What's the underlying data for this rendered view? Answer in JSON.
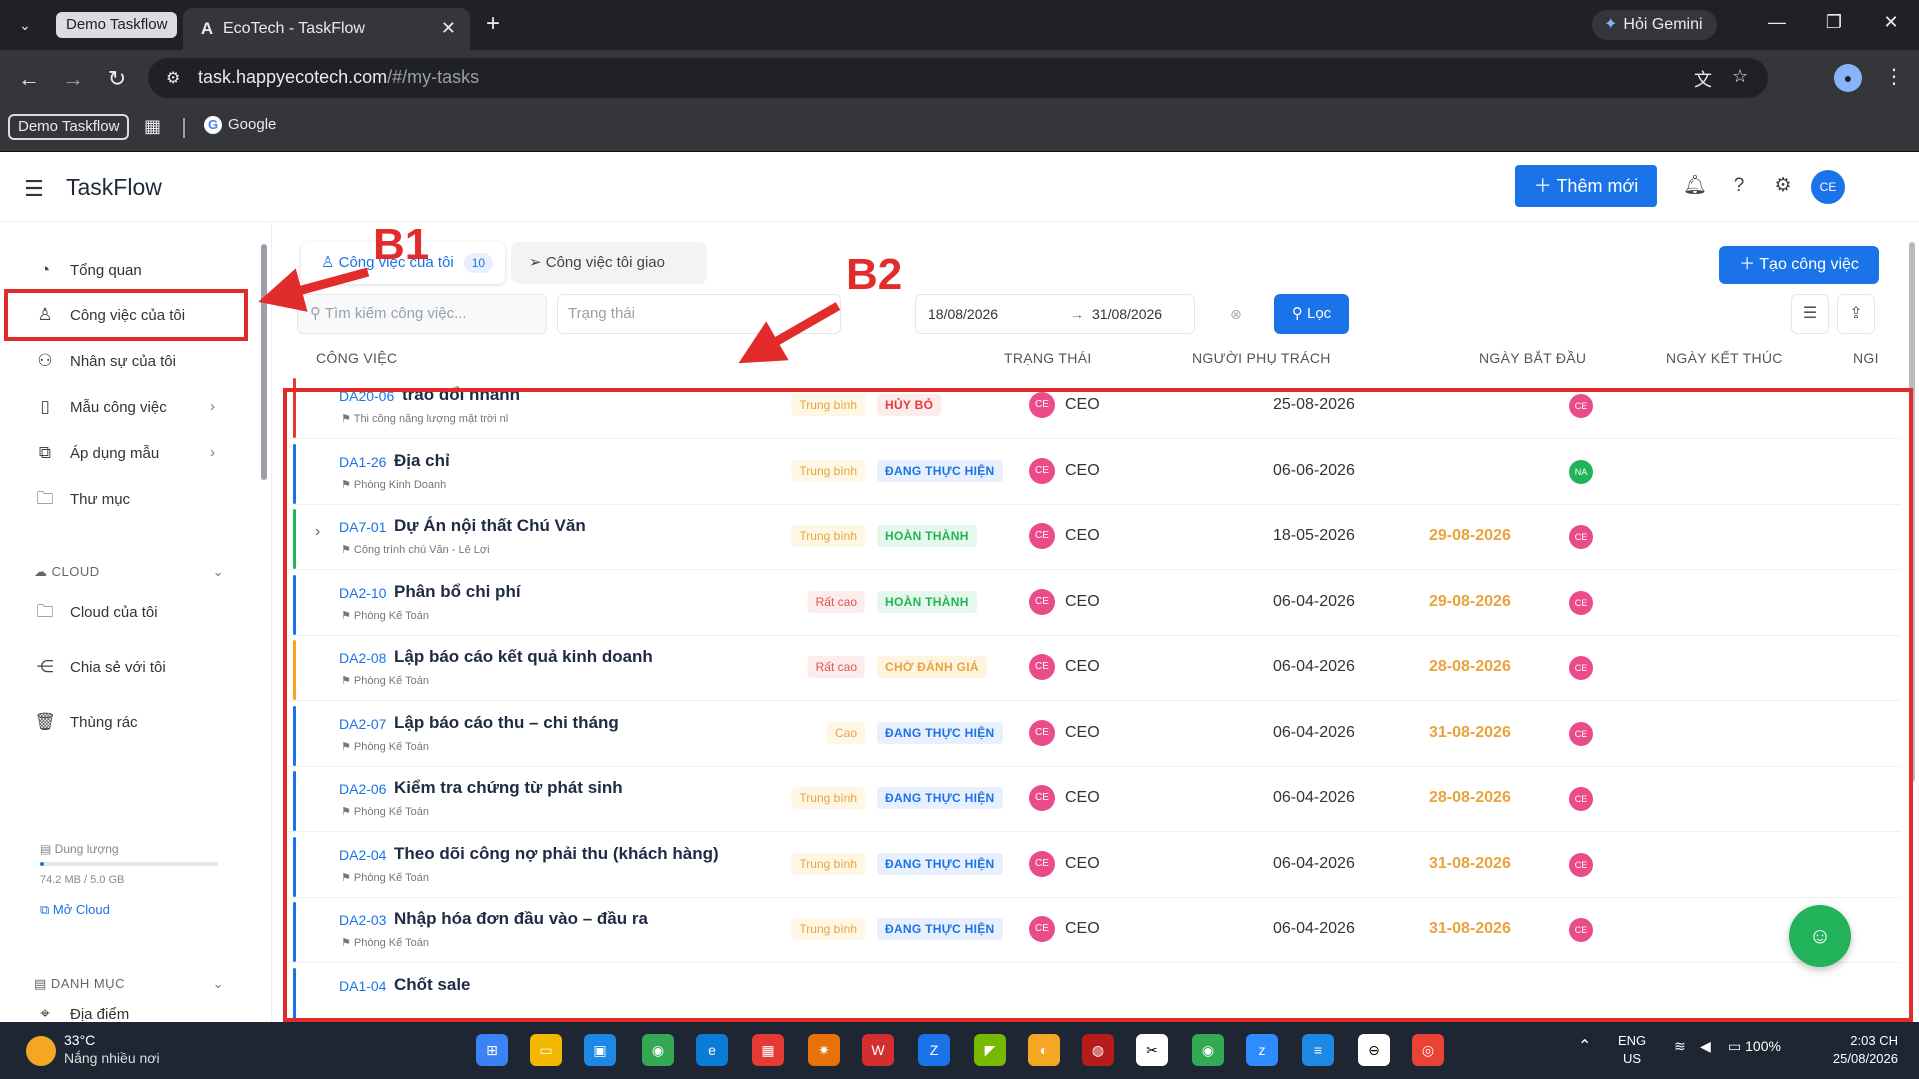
{
  "browser": {
    "tab_group": "Demo Taskflow",
    "tab_title": "EcoTech - TaskFlow",
    "gemini_label": "Hỏi Gemini",
    "url_host": "task.happyecotech.com",
    "url_path": "/#/my-tasks",
    "bookmark_group": "Demo Taskflow",
    "bookmark_google": "Google"
  },
  "app": {
    "brand": "TaskFlow",
    "add_new": "Thêm mới",
    "user_initials": "CE"
  },
  "sidebar": {
    "items": [
      {
        "label": "Tổng quan",
        "icon": "dashboard-icon"
      },
      {
        "label": "Công việc của tôi",
        "icon": "user-icon"
      },
      {
        "label": "Nhân sự của tôi",
        "icon": "users-icon"
      },
      {
        "label": "Mẫu công việc",
        "icon": "file-icon"
      },
      {
        "label": "Áp dụng mẫu",
        "icon": "copy-icon"
      },
      {
        "label": "Thư mục",
        "icon": "folder-icon"
      }
    ],
    "cloud_header": "CLOUD",
    "cloud_items": [
      {
        "label": "Cloud của tôi",
        "icon": "folder-icon"
      },
      {
        "label": "Chia sẻ với tôi",
        "icon": "share-icon"
      },
      {
        "label": "Thùng rác",
        "icon": "trash-icon"
      }
    ],
    "storage_label": "Dung lượng",
    "storage_used": "74.2 MB / 5.0 GB",
    "storage_fraction": 0.015,
    "open_cloud": "Mở Cloud",
    "category_header": "DANH MỤC",
    "category_items": [
      {
        "label": "Địa điểm",
        "icon": "location-icon"
      }
    ]
  },
  "tabs": {
    "mine": "Công việc của tôi",
    "mine_count": "10",
    "assigned": "Công việc tôi giao"
  },
  "toolbar": {
    "create_task": "Tạo công việc",
    "search_placeholder": "Tìm kiếm công việc...",
    "status_placeholder": "Trạng thái",
    "date_from": "18/08/2026",
    "date_to": "31/08/2026",
    "filter": "Lọc"
  },
  "table": {
    "columns": [
      "CÔNG VIỆC",
      "TRẠNG THÁI",
      "NGƯỜI PHỤ TRÁCH",
      "NGÀY BẮT ĐẦU",
      "NGÀY KẾT THÚC",
      "NGI"
    ],
    "rows": [
      {
        "code": "DA20-06",
        "title": "trao đổi nhanh",
        "sub": "Thi công năng lượng mặt trời nl",
        "priority": "Trung bình",
        "status": "HỦY BỎ",
        "owner": "CEO",
        "owner_initials": "CE",
        "start": "25-08-2026",
        "end": "",
        "assignee_initials": "CE",
        "bar_color": "#e53935",
        "status_bg": "#fdecec",
        "status_fg": "#e53935",
        "expandable": false
      },
      {
        "code": "DA1-26",
        "title": "Địa chỉ",
        "sub": "Phòng Kinh Doanh",
        "priority": "Trung bình",
        "status": "ĐANG THỰC HIỆN",
        "owner": "CEO",
        "owner_initials": "CE",
        "start": "06-06-2026",
        "end": "",
        "assignee_initials": "NA",
        "bar_color": "#1a73e8",
        "status_bg": "#e8f0fe",
        "status_fg": "#1a73e8",
        "expandable": false
      },
      {
        "code": "DA7-01",
        "title": "Dự Án nội thất Chú Văn",
        "sub": "Công trình chú Văn - Lê Lợi",
        "priority": "Trung bình",
        "status": "HOÀN THÀNH",
        "owner": "CEO",
        "owner_initials": "CE",
        "start": "18-05-2026",
        "end": "29-08-2026",
        "assignee_initials": "CE",
        "bar_color": "#22b35a",
        "status_bg": "#e6f7ec",
        "status_fg": "#22b35a",
        "expandable": true
      },
      {
        "code": "DA2-10",
        "title": "Phân bổ chi phí",
        "sub": "Phòng Kế Toán",
        "priority": "Rất cao",
        "status": "HOÀN THÀNH",
        "owner": "CEO",
        "owner_initials": "CE",
        "start": "06-04-2026",
        "end": "29-08-2026",
        "assignee_initials": "CE",
        "bar_color": "#1a73e8",
        "status_bg": "#e6f7ec",
        "status_fg": "#22b35a",
        "expandable": false
      },
      {
        "code": "DA2-08",
        "title": "Lập báo cáo kết quả kinh doanh",
        "sub": "Phòng Kế Toán",
        "priority": "Rất cao",
        "status": "CHỜ ĐÁNH GIÁ",
        "owner": "CEO",
        "owner_initials": "CE",
        "start": "06-04-2026",
        "end": "28-08-2026",
        "assignee_initials": "CE",
        "bar_color": "#f5a623",
        "status_bg": "#fff4e0",
        "status_fg": "#e8a33d",
        "expandable": false
      },
      {
        "code": "DA2-07",
        "title": "Lập báo cáo thu – chi tháng",
        "sub": "Phòng Kế Toán",
        "priority": "Cao",
        "status": "ĐANG THỰC HIỆN",
        "owner": "CEO",
        "owner_initials": "CE",
        "start": "06-04-2026",
        "end": "31-08-2026",
        "assignee_initials": "CE",
        "bar_color": "#1a73e8",
        "status_bg": "#e8f0fe",
        "status_fg": "#1a73e8",
        "expandable": false
      },
      {
        "code": "DA2-06",
        "title": "Kiểm tra chứng từ phát sinh",
        "sub": "Phòng Kế Toán",
        "priority": "Trung bình",
        "status": "ĐANG THỰC HIỆN",
        "owner": "CEO",
        "owner_initials": "CE",
        "start": "06-04-2026",
        "end": "28-08-2026",
        "assignee_initials": "CE",
        "bar_color": "#1a73e8",
        "status_bg": "#e8f0fe",
        "status_fg": "#1a73e8",
        "expandable": false
      },
      {
        "code": "DA2-04",
        "title": "Theo dõi công nợ phải thu (khách hàng)",
        "sub": "Phòng Kế Toán",
        "priority": "Trung bình",
        "status": "ĐANG THỰC HIỆN",
        "owner": "CEO",
        "owner_initials": "CE",
        "start": "06-04-2026",
        "end": "31-08-2026",
        "assignee_initials": "CE",
        "bar_color": "#1a73e8",
        "status_bg": "#e8f0fe",
        "status_fg": "#1a73e8",
        "expandable": false
      },
      {
        "code": "DA2-03",
        "title": "Nhập hóa đơn đầu vào – đầu ra",
        "sub": "Phòng Kế Toán",
        "priority": "Trung bình",
        "status": "ĐANG THỰC HIỆN",
        "owner": "CEO",
        "owner_initials": "CE",
        "start": "06-04-2026",
        "end": "31-08-2026",
        "assignee_initials": "CE",
        "bar_color": "#1a73e8",
        "status_bg": "#e8f0fe",
        "status_fg": "#1a73e8",
        "expandable": false
      },
      {
        "code": "DA1-04",
        "title": "Chốt sale",
        "sub": "",
        "priority": "",
        "status": "",
        "owner": "",
        "owner_initials": "",
        "start": "",
        "end": "",
        "assignee_initials": "",
        "bar_color": "#1a73e8",
        "status_bg": "transparent",
        "status_fg": "#1a73e8",
        "expandable": false
      }
    ]
  },
  "annotations": {
    "b1": "B1",
    "b2": "B2",
    "color": "#e22b2b"
  },
  "taskbar": {
    "temp": "33°C",
    "weather": "Nắng nhiều nơi",
    "lang1": "ENG",
    "lang2": "US",
    "battery": "100%",
    "time": "2:03 CH",
    "date": "25/08/2026"
  },
  "colors": {
    "accent": "#1a73e8",
    "fab": "#22b35a"
  }
}
